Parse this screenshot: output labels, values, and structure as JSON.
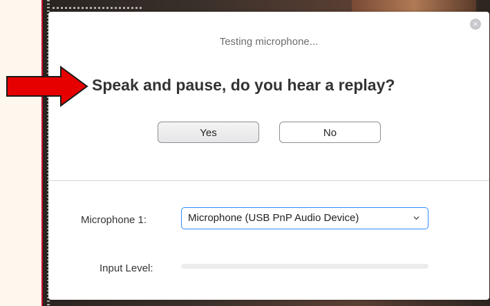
{
  "dialog": {
    "close_glyph": "×",
    "status_text": "Testing microphone...",
    "question": "Speak and pause, do you hear a replay?",
    "yes_label": "Yes",
    "no_label": "No"
  },
  "microphone": {
    "label": "Microphone 1:",
    "selected": "Microphone (USB PnP Audio Device)"
  },
  "input_level": {
    "label": "Input Level:",
    "level": 0
  },
  "annotation": {
    "arrow_icon": "red-arrow-icon",
    "arrow_color": "#e60000"
  },
  "colors": {
    "accent": "#2d8cff",
    "frame_border": "#c8102e"
  }
}
